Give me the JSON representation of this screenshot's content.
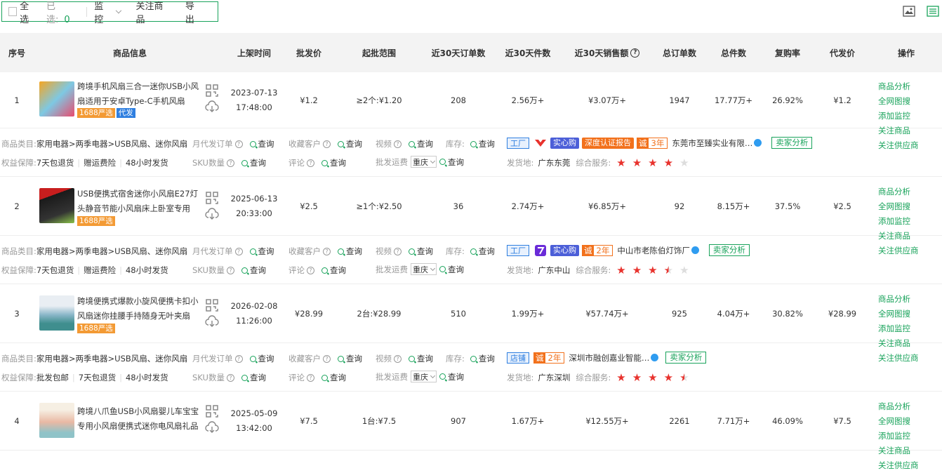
{
  "toolbar": {
    "select_all": "全选",
    "selected_label": "已选:",
    "selected_count": "0",
    "monitor": "监控",
    "follow": "关注商品",
    "export": "导出"
  },
  "columns": [
    "序号",
    "商品信息",
    "上架时间",
    "批发价",
    "起批范围",
    "近30天订单数",
    "近30天件数",
    "近30天销售额",
    "总订单数",
    "总件数",
    "复购率",
    "代发价",
    "操作"
  ],
  "ops": [
    "商品分析",
    "全网图搜",
    "添加监控",
    "关注商品",
    "关注供应商"
  ],
  "labels": {
    "category": "商品类目:",
    "monthly_orders": "月代发订单",
    "fav": "收藏客户",
    "video": "视频",
    "stock": "库存:",
    "guarantee": "权益保障:",
    "sku": "SKU数量",
    "review": "评论",
    "freight": "批发运费",
    "ship_from": "发货地:",
    "service": "综合服务:",
    "query": "查询",
    "seller_analysis": "卖家分析",
    "region": "重庆"
  },
  "products": [
    {
      "index": "1",
      "title": "跨境手机风扇三合一迷你USB小风扇适用于安卓Type-C手机风扇",
      "badges": [
        "1688严选",
        "代发"
      ],
      "date": "2023-07-13",
      "time": "17:48:00",
      "price": "¥1.2",
      "range": "≥2个:¥1.20",
      "orders30": "208",
      "pieces30": "2.56万+",
      "sales30": "¥3.07万+",
      "total_orders": "1947",
      "total_pieces": "17.77万+",
      "repurchase": "26.92%",
      "dropship": "¥1.2",
      "category": "家用电器>两季电器>USB风扇、迷你风扇",
      "guarantees": [
        "7天包退货",
        "赠运费险",
        "48小时发货"
      ],
      "store_tag": "工厂",
      "cert": "深度认证报告",
      "years": "3年",
      "company": "东莞市至臻实业有限…",
      "ship": "广东东莞",
      "stars": [
        1,
        1,
        1,
        1,
        0
      ]
    },
    {
      "index": "2",
      "title": "USB便携式宿舍迷你小风扇E27灯头静音节能小风扇床上卧室专用",
      "badges": [
        "1688严选"
      ],
      "date": "2025-06-13",
      "time": "20:33:00",
      "price": "¥2.5",
      "range": "≥1个:¥2.50",
      "orders30": "36",
      "pieces30": "2.74万+",
      "sales30": "¥6.85万+",
      "total_orders": "92",
      "total_pieces": "8.15万+",
      "repurchase": "37.5%",
      "dropship": "¥2.5",
      "category": "家用电器>两季电器>USB风扇、迷你风扇",
      "guarantees": [
        "7天包退货",
        "赠运费险",
        "48小时发货"
      ],
      "store_tag": "工厂",
      "cert": "",
      "years": "2年",
      "company": "中山市老陈伯灯饰厂",
      "ship": "广东中山",
      "stars": [
        1,
        1,
        1,
        0.5,
        0
      ]
    },
    {
      "index": "3",
      "title": "跨境便携式爆款小旋风便携卡扣小风扇迷你挂腰手持随身无叶夹扇",
      "badges": [
        "1688严选"
      ],
      "date": "2026-02-08",
      "time": "11:26:00",
      "price": "¥28.99",
      "range": "2台:¥28.99",
      "orders30": "510",
      "pieces30": "1.99万+",
      "sales30": "¥57.74万+",
      "total_orders": "925",
      "total_pieces": "4.04万+",
      "repurchase": "30.82%",
      "dropship": "¥28.99",
      "category": "家用电器>两季电器>USB风扇、迷你风扇",
      "guarantees": [
        "批发包邮",
        "7天包退货",
        "48小时发货"
      ],
      "store_tag": "店铺",
      "cert": "",
      "years": "2年",
      "company": "深圳市融创嘉业智能…",
      "ship": "广东深圳",
      "stars": [
        1,
        1,
        1,
        1,
        0.5
      ]
    },
    {
      "index": "4",
      "title": "跨境八爪鱼USB小风扇婴儿车宝宝专用小风扇便携式迷你电风扇礼品",
      "badges": [],
      "date": "2025-05-09",
      "time": "13:42:00",
      "price": "¥7.5",
      "range": "1台:¥7.5",
      "orders30": "907",
      "pieces30": "1.67万+",
      "sales30": "¥12.55万+",
      "total_orders": "2261",
      "total_pieces": "7.71万+",
      "repurchase": "46.09%",
      "dropship": "¥7.5"
    }
  ],
  "colors": {
    "accent": "#19a35b",
    "badge_orange": "#f39a34",
    "badge_blue": "#2f7fe0",
    "star": "#e8322d"
  }
}
